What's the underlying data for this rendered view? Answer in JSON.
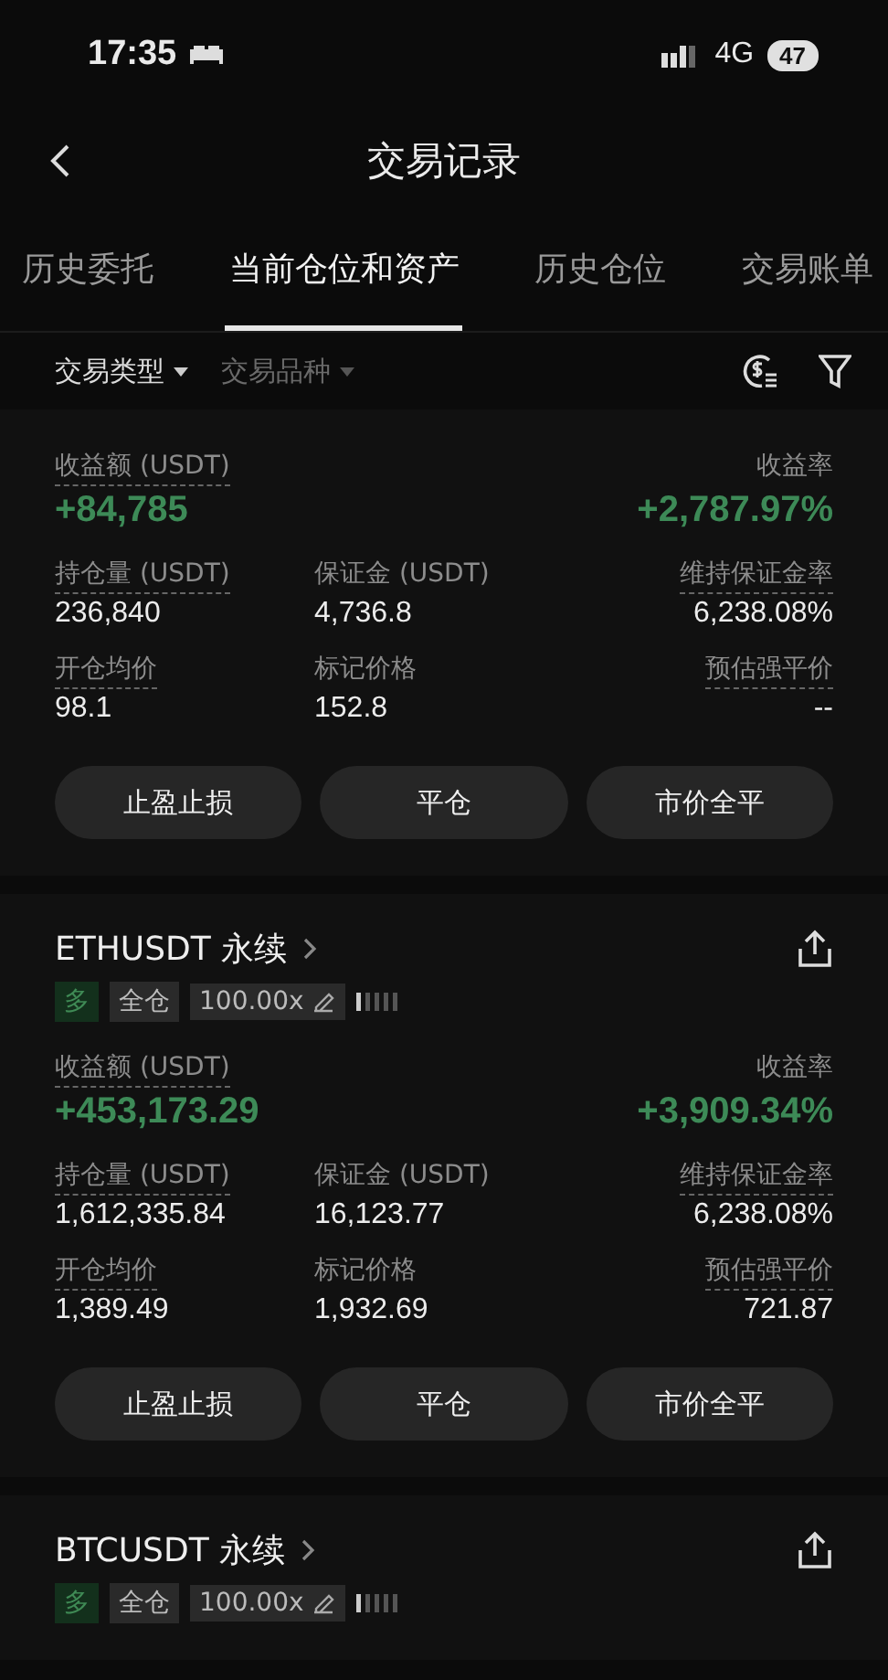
{
  "status_bar": {
    "time": "17:35",
    "network": "4G",
    "battery": "47"
  },
  "nav": {
    "title": "交易记录"
  },
  "tabs": [
    {
      "label": "历史委托",
      "selected": false
    },
    {
      "label": "当前仓位和资产",
      "selected": true
    },
    {
      "label": "历史仓位",
      "selected": false
    },
    {
      "label": "交易账单",
      "selected": false
    }
  ],
  "filters": [
    {
      "label": "交易类型",
      "active": true
    },
    {
      "label": "交易品种",
      "active": false
    }
  ],
  "positions": [
    {
      "stats": {
        "pnl": {
          "label": "收益额 (USDT)",
          "value": "+84,785"
        },
        "roi": {
          "label": "收益率",
          "value": "+2,787.97%"
        },
        "cells": [
          {
            "label": "持仓量 (USDT)",
            "value": "236,840",
            "dashed": true
          },
          {
            "label": "保证金 (USDT)",
            "value": "4,736.8",
            "dashed": false
          },
          {
            "label": "维持保证金率",
            "value": "6,238.08%",
            "dashed": true
          },
          {
            "label": "开仓均价",
            "value": "98.1",
            "dashed": true
          },
          {
            "label": "标记价格",
            "value": "152.8",
            "dashed": false
          },
          {
            "label": "预估强平价",
            "value": "--",
            "dashed": true
          }
        ]
      },
      "buttons": [
        "止盈止损",
        "平仓",
        "市价全平"
      ]
    },
    {
      "symbol": "ETHUSDT 永续",
      "tags": {
        "side": "多",
        "margin": "全仓",
        "leverage": "100.00x"
      },
      "stats": {
        "pnl": {
          "label": "收益额 (USDT)",
          "value": "+453,173.29"
        },
        "roi": {
          "label": "收益率",
          "value": "+3,909.34%"
        },
        "cells": [
          {
            "label": "持仓量 (USDT)",
            "value": "1,612,335.84",
            "dashed": true
          },
          {
            "label": "保证金 (USDT)",
            "value": "16,123.77",
            "dashed": false
          },
          {
            "label": "维持保证金率",
            "value": "6,238.08%",
            "dashed": true
          },
          {
            "label": "开仓均价",
            "value": "1,389.49",
            "dashed": true
          },
          {
            "label": "标记价格",
            "value": "1,932.69",
            "dashed": false
          },
          {
            "label": "预估强平价",
            "value": "721.87",
            "dashed": true
          }
        ]
      },
      "buttons": [
        "止盈止损",
        "平仓",
        "市价全平"
      ]
    },
    {
      "symbol": "BTCUSDT 永续",
      "tags": {
        "side": "多",
        "margin": "全仓",
        "leverage": "100.00x"
      }
    }
  ]
}
